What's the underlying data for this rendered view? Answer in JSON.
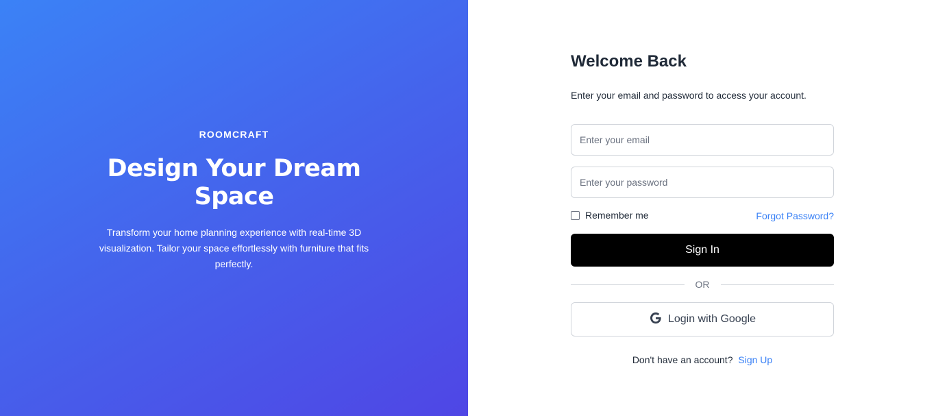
{
  "hero": {
    "brand": "ROOMCRAFT",
    "title": "Design Your Dream Space",
    "description": "Transform your home planning experience with real-time 3D visualization. Tailor your space effortlessly with furniture that fits perfectly.",
    "gradient_start": "#3b82f6",
    "gradient_end": "#4f46e5"
  },
  "form": {
    "title": "Welcome Back",
    "subtitle": "Enter your email and password to access your account.",
    "email_placeholder": "Enter your email",
    "email_value": "",
    "password_placeholder": "Enter your password",
    "password_value": "",
    "remember_label": "Remember me",
    "remember_checked": false,
    "forgot_label": "Forgot Password?",
    "signin_label": "Sign In",
    "divider_label": "OR",
    "google_label": "Login with Google",
    "google_icon": "google-g-icon",
    "signup_prompt": "Don't have an account?",
    "signup_label": "Sign Up",
    "accent_color": "#3b82f6"
  }
}
